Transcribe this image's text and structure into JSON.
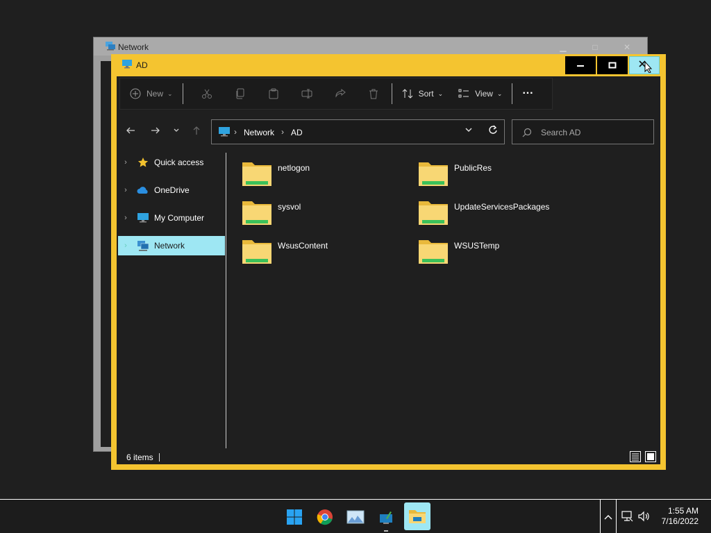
{
  "background_window": {
    "title": "Network"
  },
  "window": {
    "title": "AD",
    "accent_color": "#f4c430",
    "selection_color": "#9ee7f3"
  },
  "toolbar": {
    "new_label": "New",
    "sort_label": "Sort",
    "view_label": "View",
    "more_label": "···"
  },
  "address": {
    "crumbs": [
      "Network",
      "AD"
    ]
  },
  "search": {
    "placeholder": "Search AD"
  },
  "nav": {
    "items": [
      {
        "label": "Quick access",
        "icon": "star-icon"
      },
      {
        "label": "OneDrive",
        "icon": "cloud-icon"
      },
      {
        "label": "My Computer",
        "icon": "computer-icon"
      },
      {
        "label": "Network",
        "icon": "network-icon",
        "selected": true
      }
    ]
  },
  "files": [
    {
      "name": "netlogon"
    },
    {
      "name": "PublicRes"
    },
    {
      "name": "sysvol"
    },
    {
      "name": "UpdateServicesPackages"
    },
    {
      "name": "WsusContent"
    },
    {
      "name": "WSUSTemp"
    }
  ],
  "status": {
    "item_count": "6 items"
  },
  "taskbar": {
    "time": "1:55 AM",
    "date": "7/16/2022"
  }
}
